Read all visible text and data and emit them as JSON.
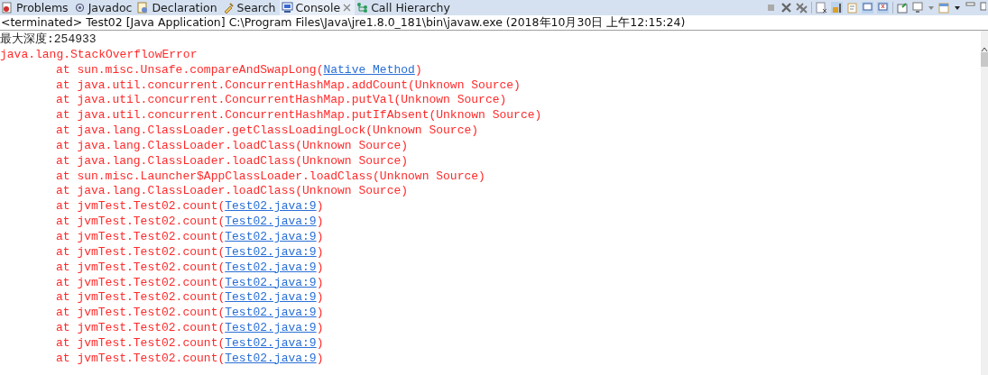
{
  "tabs": [
    {
      "label": "Problems",
      "selected": false
    },
    {
      "label": "Javadoc",
      "selected": false
    },
    {
      "label": "Declaration",
      "selected": false
    },
    {
      "label": "Search",
      "selected": false
    },
    {
      "label": "Console",
      "selected": true
    },
    {
      "label": "Call Hierarchy",
      "selected": false
    }
  ],
  "console": {
    "title": "<terminated> Test02 [Java Application] C:\\Program Files\\Java\\jre1.8.0_181\\bin\\javaw.exe (2018年10月30日 上午12:15:24)",
    "lines": [
      {
        "kind": "output",
        "text": "最大深度:254933"
      },
      {
        "kind": "error",
        "text": "java.lang.StackOverflowError"
      },
      {
        "kind": "frame",
        "text": "at sun.misc.Unsafe.compareAndSwapLong(",
        "link": "Native Method",
        "after": ")"
      },
      {
        "kind": "frame",
        "text": "at java.util.concurrent.ConcurrentHashMap.addCount(Unknown Source)"
      },
      {
        "kind": "frame",
        "text": "at java.util.concurrent.ConcurrentHashMap.putVal(Unknown Source)"
      },
      {
        "kind": "frame",
        "text": "at java.util.concurrent.ConcurrentHashMap.putIfAbsent(Unknown Source)"
      },
      {
        "kind": "frame",
        "text": "at java.lang.ClassLoader.getClassLoadingLock(Unknown Source)"
      },
      {
        "kind": "frame",
        "text": "at java.lang.ClassLoader.loadClass(Unknown Source)"
      },
      {
        "kind": "frame",
        "text": "at java.lang.ClassLoader.loadClass(Unknown Source)"
      },
      {
        "kind": "frame",
        "text": "at sun.misc.Launcher$AppClassLoader.loadClass(Unknown Source)"
      },
      {
        "kind": "frame",
        "text": "at java.lang.ClassLoader.loadClass(Unknown Source)"
      },
      {
        "kind": "frame",
        "text": "at jvmTest.Test02.count(",
        "link": "Test02.java:9",
        "after": ")"
      },
      {
        "kind": "frame",
        "text": "at jvmTest.Test02.count(",
        "link": "Test02.java:9",
        "after": ")"
      },
      {
        "kind": "frame",
        "text": "at jvmTest.Test02.count(",
        "link": "Test02.java:9",
        "after": ")"
      },
      {
        "kind": "frame",
        "text": "at jvmTest.Test02.count(",
        "link": "Test02.java:9",
        "after": ")"
      },
      {
        "kind": "frame",
        "text": "at jvmTest.Test02.count(",
        "link": "Test02.java:9",
        "after": ")"
      },
      {
        "kind": "frame",
        "text": "at jvmTest.Test02.count(",
        "link": "Test02.java:9",
        "after": ")"
      },
      {
        "kind": "frame",
        "text": "at jvmTest.Test02.count(",
        "link": "Test02.java:9",
        "after": ")"
      },
      {
        "kind": "frame",
        "text": "at jvmTest.Test02.count(",
        "link": "Test02.java:9",
        "after": ")"
      },
      {
        "kind": "frame",
        "text": "at jvmTest.Test02.count(",
        "link": "Test02.java:9",
        "after": ")"
      },
      {
        "kind": "frame",
        "text": "at jvmTest.Test02.count(",
        "link": "Test02.java:9",
        "after": ")"
      },
      {
        "kind": "frame",
        "text": "at jvmTest.Test02.count(",
        "link": "Test02.java:9",
        "after": ")"
      }
    ]
  }
}
